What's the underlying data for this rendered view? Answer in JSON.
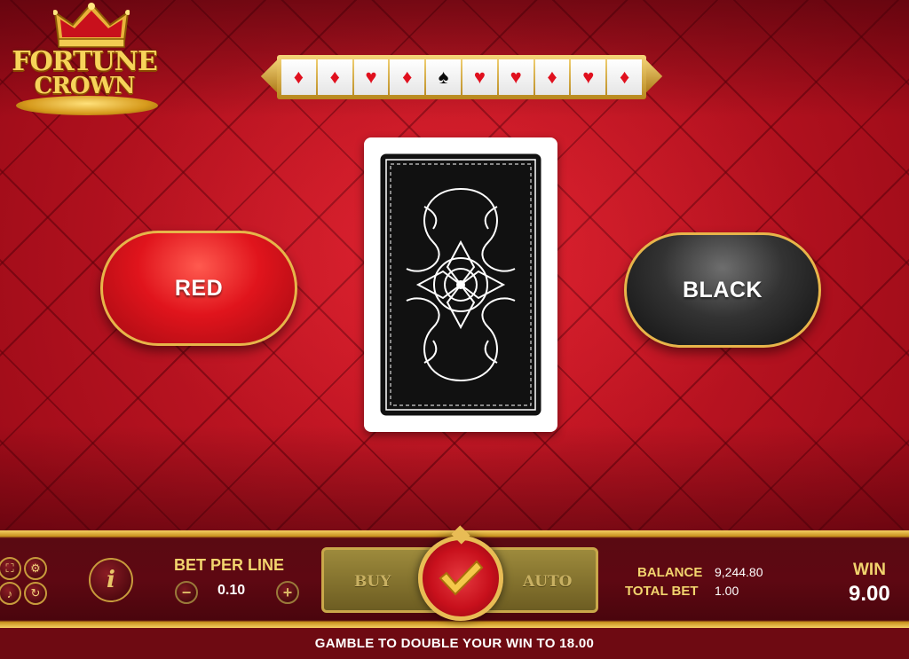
{
  "logo": {
    "line1": "FORTUNE",
    "line2": "CROWN"
  },
  "history": {
    "cards": [
      {
        "suit": "♦",
        "color": "red"
      },
      {
        "suit": "♦",
        "color": "red"
      },
      {
        "suit": "♥",
        "color": "red"
      },
      {
        "suit": "♦",
        "color": "red"
      },
      {
        "suit": "♠",
        "color": "black"
      },
      {
        "suit": "♥",
        "color": "red"
      },
      {
        "suit": "♥",
        "color": "red"
      },
      {
        "suit": "♦",
        "color": "red"
      },
      {
        "suit": "♥",
        "color": "red"
      },
      {
        "suit": "♦",
        "color": "red"
      }
    ]
  },
  "gamble": {
    "red_label": "RED",
    "black_label": "BLACK"
  },
  "panel": {
    "bet_per_line_label": "BET PER LINE",
    "bet_per_line_value": "0.10",
    "minus": "−",
    "plus": "+",
    "info": "i",
    "buy_label": "BUY",
    "auto_label": "AUTO",
    "balance_label": "BALANCE",
    "balance_value": "9,244.80",
    "total_bet_label": "TOTAL BET",
    "total_bet_value": "1.00",
    "win_label": "WIN",
    "win_value": "9.00"
  },
  "footer": {
    "message": "GAMBLE TO DOUBLE YOUR WIN TO 18.00"
  },
  "colors": {
    "red": "#e0141c",
    "black": "#333333",
    "gold": "#e8bc55"
  },
  "icons": [
    "fullscreen-icon",
    "settings-icon",
    "sound-icon",
    "history-icon",
    "info-icon",
    "checkmark-icon"
  ]
}
